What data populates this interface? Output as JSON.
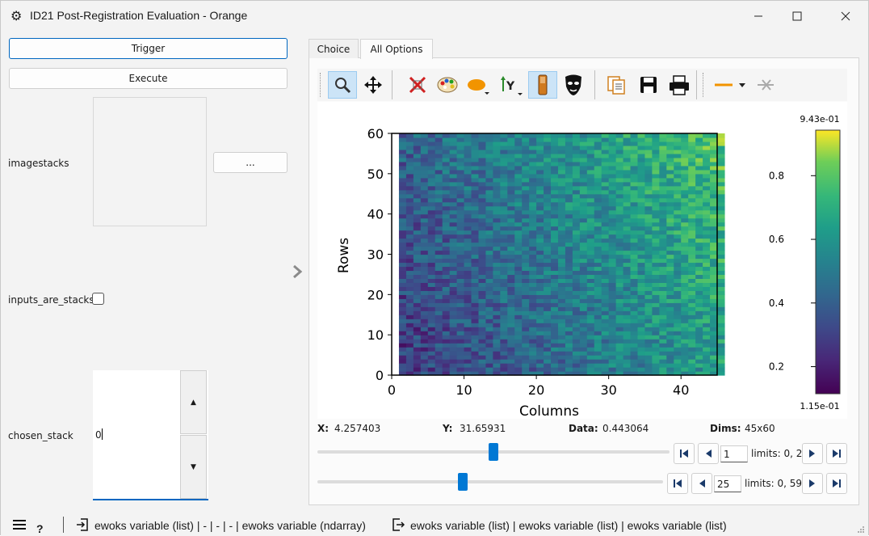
{
  "window": {
    "title": "ID21 Post-Registration Evaluation - Orange"
  },
  "left_panel": {
    "trigger_label": "Trigger",
    "execute_label": "Execute",
    "imagestacks_label": "imagestacks",
    "browse_label": "...",
    "inputs_are_stacks_label": "inputs_are_stacks",
    "chosen_stack_label": "chosen_stack",
    "chosen_stack_value": "0"
  },
  "tabs": [
    {
      "label": "Choice"
    },
    {
      "label": "All Options"
    }
  ],
  "toolbar": {
    "icons": [
      "zoom-icon",
      "pan-icon",
      "reset-zoom-icon",
      "colormap-icon",
      "roi-shape-icon",
      "y-axis-icon",
      "keep-aspect-icon",
      "mask-icon",
      "copy-icon",
      "save-icon",
      "print-icon",
      "line-style-icon",
      "clear-icon"
    ]
  },
  "chart_data": {
    "type": "heatmap",
    "xlabel": "Columns",
    "ylabel": "Rows",
    "xlim": [
      0,
      45
    ],
    "ylim": [
      0,
      60
    ],
    "xticks": [
      "0",
      "10",
      "20",
      "30",
      "40"
    ],
    "yticks": [
      "0",
      "10",
      "20",
      "30",
      "40",
      "50",
      "60"
    ],
    "dims": [
      45,
      60
    ],
    "colorbar": {
      "min_label": "1.15e-01",
      "max_label": "9.43e-01",
      "min": 0.115,
      "max": 0.943,
      "ticks": [
        "0.2",
        "0.4",
        "0.6",
        "0.8"
      ]
    },
    "colormap": "viridis"
  },
  "info": {
    "x_label": "X:",
    "x_value": "4.257403",
    "y_label": "Y:",
    "y_value": "31.65931",
    "data_label": "Data:",
    "data_value": "0.443064",
    "dims_label": "Dims:",
    "dims_value": "45x60"
  },
  "frame_slider": {
    "value": "1",
    "limits": "limits: 0, 2",
    "level": 0.5
  },
  "row_slider": {
    "value": "25",
    "limits": "limits: 0, 59",
    "level": 0.42
  },
  "statusbar": {
    "inputs_text": "ewoks variable (list) | - | - | - | ewoks variable (ndarray)",
    "outputs_text": "ewoks variable (list) | ewoks variable (list) | ewoks variable (list)"
  },
  "colors": {
    "accent": "#0078d4",
    "focus": "#0067c0"
  }
}
